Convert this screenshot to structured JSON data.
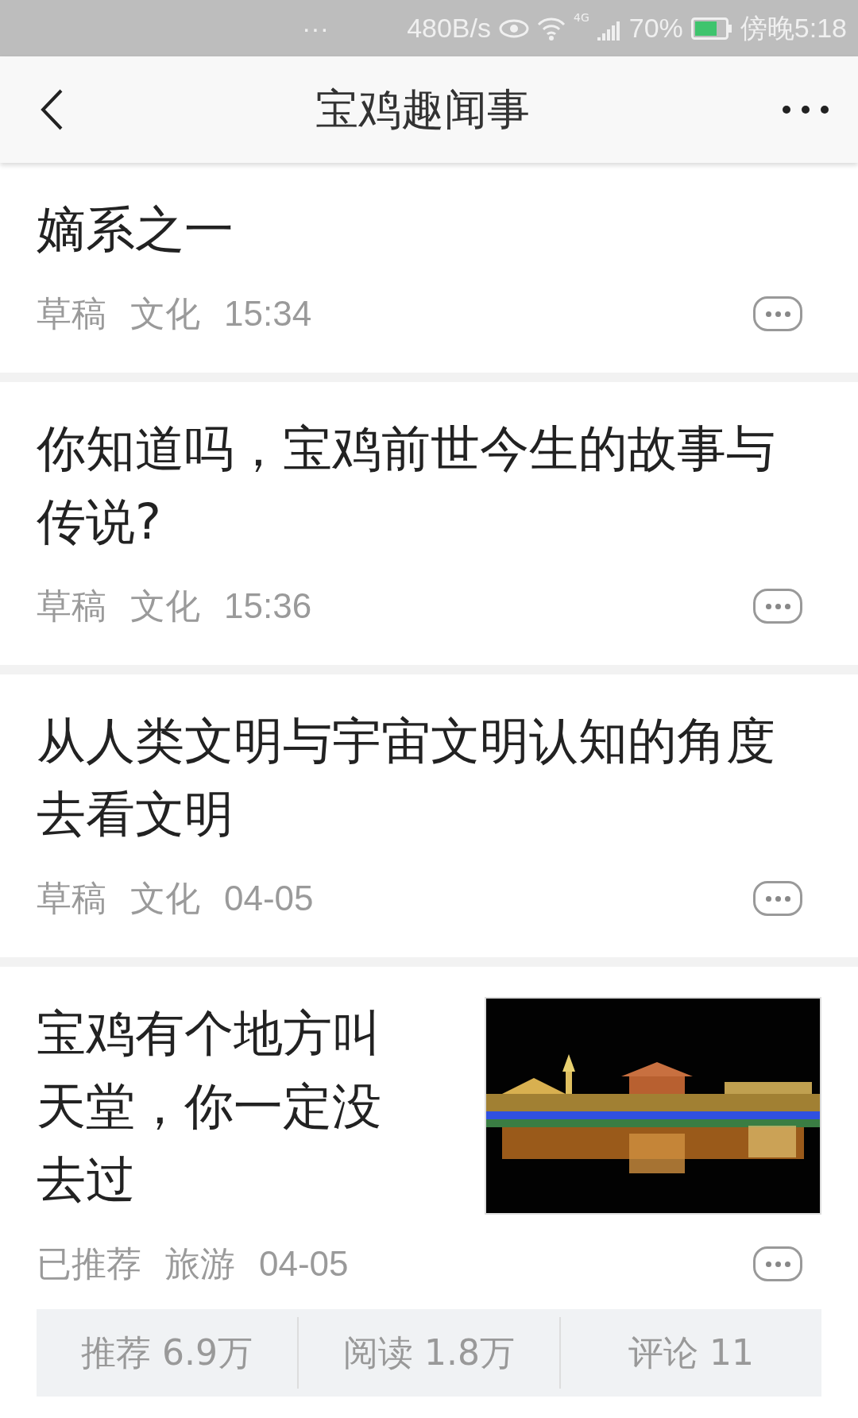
{
  "status_bar": {
    "notifications": "···",
    "speed": "480B/s",
    "network": "4G",
    "battery": "70%",
    "time": "傍晚5:18"
  },
  "header": {
    "title": "宝鸡趣闻事"
  },
  "articles": [
    {
      "title": "嫡系之一",
      "status": "草稿",
      "category": "文化",
      "time": "15:34"
    },
    {
      "title": "你知道吗，宝鸡前世今生的故事与传说?",
      "status": "草稿",
      "category": "文化",
      "time": "15:36"
    },
    {
      "title": "从人类文明与宇宙文明认知的角度去看文明",
      "status": "草稿",
      "category": "文化",
      "time": "04-05"
    },
    {
      "title": "宝鸡有个地方叫天堂，你一定没去过",
      "status": "已推荐",
      "category": "旅游",
      "time": "04-05",
      "thumbnail": {
        "kind": "picture"
      },
      "stats": [
        "推荐 6.9万",
        "阅读 1.8万",
        "评论 11"
      ]
    }
  ]
}
